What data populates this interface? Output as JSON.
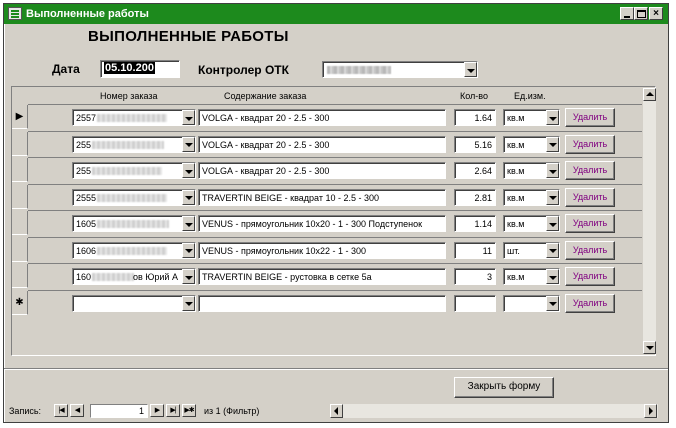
{
  "window": {
    "title": "Выполненные работы",
    "buttons": {
      "minimize": "",
      "maximize": "",
      "close": "×"
    }
  },
  "form": {
    "heading": "ВЫПОЛНЕННЫЕ РАБОТЫ",
    "date_label": "Дата",
    "date_value": "05.10.200",
    "controller_label": "Контролер ОТК",
    "controller_value": ""
  },
  "grid": {
    "columns": {
      "order_number": "Номер заказа",
      "content": "Содержание заказа",
      "quantity": "Кол-во",
      "unit": "Ед.изм."
    },
    "current_row_marker": "▶",
    "new_row_marker": "✱",
    "delete_label": "Удалить",
    "rows": [
      {
        "order_number": "2557",
        "order_suffix": "",
        "content": "VOLGA - квадрат 20 - 2.5 - 300",
        "quantity": "1.64",
        "unit": "кв.м"
      },
      {
        "order_number": "255",
        "order_suffix": "",
        "content": "VOLGA - квадрат 20 - 2.5 - 300",
        "quantity": "5.16",
        "unit": "кв.м"
      },
      {
        "order_number": "255",
        "order_suffix": "",
        "content": "VOLGA - квадрат 20 - 2.5 - 300",
        "quantity": "2.64",
        "unit": "кв.м"
      },
      {
        "order_number": "2555",
        "order_suffix": "",
        "content": "TRAVERTIN BEIGE - квадрат 10 - 2.5 - 300",
        "quantity": "2.81",
        "unit": "кв.м"
      },
      {
        "order_number": "1605",
        "order_suffix": "",
        "content": "VENUS - прямоугольник 10х20 - 1 - 300  Подступенок",
        "quantity": "1.14",
        "unit": "кв.м"
      },
      {
        "order_number": "1606",
        "order_suffix": "",
        "content": "VENUS - прямоугольник 10х22 - 1 - 300",
        "quantity": "11",
        "unit": "шт."
      },
      {
        "order_number": "160",
        "order_suffix": "ов Юрий А",
        "content": "TRAVERTIN BEIGE - рустовка в сетке 5а",
        "quantity": "3",
        "unit": "кв.м"
      },
      {
        "order_number": "",
        "order_suffix": "",
        "content": "",
        "quantity": "",
        "unit": ""
      }
    ]
  },
  "footer": {
    "close_form_label": "Закрыть форму",
    "record_label": "Запись:",
    "nav_first": "|◀",
    "nav_prev": "◀",
    "nav_next": "▶",
    "nav_last": "▶|",
    "nav_new": "▶✱",
    "current_record": "1",
    "of_text": "из  1 (Фильтр)"
  }
}
